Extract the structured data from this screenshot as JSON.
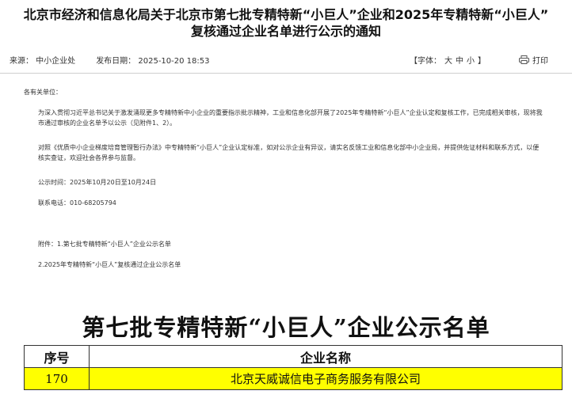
{
  "title": "北京市经济和信息化局关于北京市第七批专精特新“小巨人”企业和2025年专精特新“小巨人”\n复核通过企业名单进行公示的通知",
  "meta": {
    "source": "来源：  中小企业处",
    "date": "发布日期：  2025-10-20 18:53",
    "font_label_open": "【字体：",
    "font_large": "大",
    "font_medium": "中",
    "font_small": "小",
    "font_label_close": "】",
    "print_label": "打印",
    "print_icon": "printer-icon"
  },
  "body": {
    "salutation": "各有关单位：",
    "para1": "为深入贯彻习近平总书记关于激发涌现更多专精特新中小企业的重要指示批示精神，工业和信息化部开展了2025年专精特新“小巨人”企业认定和复核工作，已完成相关审核，现将我市通过审核的企业名单予以公示（见附件1、2）。",
    "para2": "对照《优质中小企业梯度培育管理暂行办法》中专精特新“小巨人”企业认定标准，如对公示企业有异议，请实名反馈工业和信息化部中小企业局，并提供佐证材料和联系方式，以便核实查证，欢迎社会各界参与监督。",
    "pub_time": "公示时间：2025年10月20日至10月24日",
    "phone": "联系电话：010-68205794",
    "attach1": "附件：1.第七批专精特新“小巨人”企业公示名单",
    "attach2": "2.2025年专精特新“小巨人”复核通过企业公示名单"
  },
  "list": {
    "heading": "第七批专精特新“小巨人”企业公示名单",
    "headers": [
      "序号",
      "企业名称"
    ],
    "rows": [
      [
        "170",
        "北京天威诚信电子商务服务有限公司"
      ]
    ],
    "highlight_color": "#ffff00"
  }
}
